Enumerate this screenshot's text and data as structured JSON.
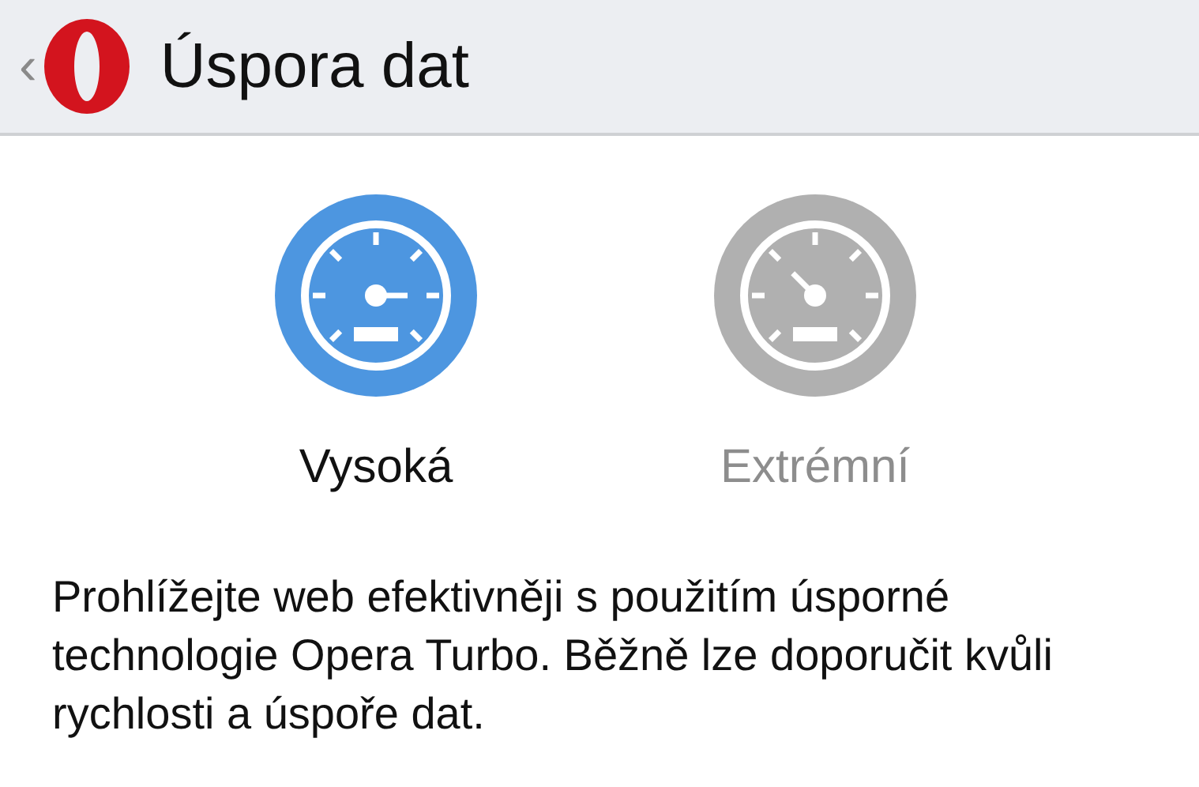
{
  "header": {
    "title": "Úspora dat",
    "back": "‹"
  },
  "modes": [
    {
      "label": "Vysoká",
      "kind": "high",
      "selected": true
    },
    {
      "label": "Extrémní",
      "kind": "extreme",
      "selected": false
    }
  ],
  "description": "Prohlížejte web efektivněji s použitím úsporné technologie Opera Turbo. Běžně lze doporučit kvůli rychlosti a úspoře dat."
}
